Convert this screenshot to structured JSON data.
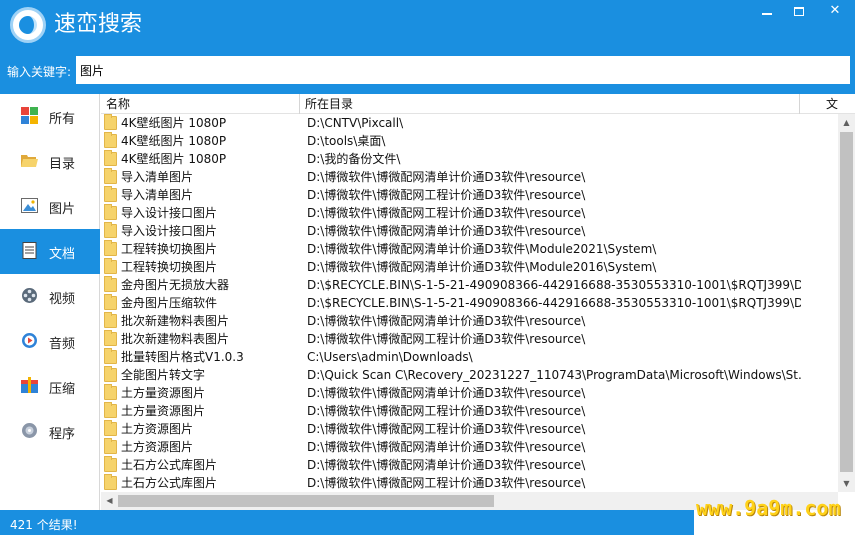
{
  "app": {
    "title": "速峦搜索"
  },
  "window_controls": {
    "minimize": "",
    "maximize": "",
    "close": "✕"
  },
  "search": {
    "label": "输入关键字:",
    "value": "图片"
  },
  "sidebar": {
    "items": [
      {
        "label": "所有",
        "icon": "grid-icon",
        "active": false
      },
      {
        "label": "目录",
        "icon": "folder-open-icon",
        "active": false
      },
      {
        "label": "图片",
        "icon": "picture-icon",
        "active": false
      },
      {
        "label": "文档",
        "icon": "document-icon",
        "active": true
      },
      {
        "label": "视频",
        "icon": "film-reel-icon",
        "active": false
      },
      {
        "label": "音频",
        "icon": "audio-play-icon",
        "active": false
      },
      {
        "label": "压缩",
        "icon": "archive-icon",
        "active": false
      },
      {
        "label": "程序",
        "icon": "program-disc-icon",
        "active": false
      }
    ]
  },
  "table": {
    "columns": [
      "名称",
      "所在目录",
      "文"
    ],
    "rows": [
      {
        "name": "4K壁纸图片 1080P",
        "path": "D:\\CNTV\\Pixcall\\"
      },
      {
        "name": "4K壁纸图片 1080P",
        "path": "D:\\tools\\桌面\\"
      },
      {
        "name": "4K壁纸图片 1080P",
        "path": "D:\\我的备份文件\\"
      },
      {
        "name": "导入清单图片",
        "path": "D:\\博微软件\\博微配网清单计价通D3软件\\resource\\"
      },
      {
        "name": "导入清单图片",
        "path": "D:\\博微软件\\博微配网工程计价通D3软件\\resource\\"
      },
      {
        "name": "导入设计接口图片",
        "path": "D:\\博微软件\\博微配网工程计价通D3软件\\resource\\"
      },
      {
        "name": "导入设计接口图片",
        "path": "D:\\博微软件\\博微配网清单计价通D3软件\\resource\\"
      },
      {
        "name": "工程转换切换图片",
        "path": "D:\\博微软件\\博微配网清单计价通D3软件\\Module2021\\System\\"
      },
      {
        "name": "工程转换切换图片",
        "path": "D:\\博微软件\\博微配网清单计价通D3软件\\Module2016\\System\\"
      },
      {
        "name": "金舟图片无损放大器",
        "path": "D:\\$RECYCLE.BIN\\S-1-5-21-490908366-442916688-3530553310-1001\\$RQTJ399\\D..."
      },
      {
        "name": "金舟图片压缩软件",
        "path": "D:\\$RECYCLE.BIN\\S-1-5-21-490908366-442916688-3530553310-1001\\$RQTJ399\\D..."
      },
      {
        "name": "批次新建物料表图片",
        "path": "D:\\博微软件\\博微配网清单计价通D3软件\\resource\\"
      },
      {
        "name": "批次新建物料表图片",
        "path": "D:\\博微软件\\博微配网工程计价通D3软件\\resource\\"
      },
      {
        "name": "批量转图片格式V1.0.3",
        "path": "C:\\Users\\admin\\Downloads\\"
      },
      {
        "name": "全能图片转文字",
        "path": "D:\\Quick Scan C\\Recovery_20231227_110743\\ProgramData\\Microsoft\\Windows\\St..."
      },
      {
        "name": "土方量资源图片",
        "path": "D:\\博微软件\\博微配网清单计价通D3软件\\resource\\"
      },
      {
        "name": "土方量资源图片",
        "path": "D:\\博微软件\\博微配网工程计价通D3软件\\resource\\"
      },
      {
        "name": "土方资源图片",
        "path": "D:\\博微软件\\博微配网工程计价通D3软件\\resource\\"
      },
      {
        "name": "土方资源图片",
        "path": "D:\\博微软件\\博微配网清单计价通D3软件\\resource\\"
      },
      {
        "name": "土石方公式库图片",
        "path": "D:\\博微软件\\博微配网清单计价通D3软件\\resource\\"
      },
      {
        "name": "土石方公式库图片",
        "path": "D:\\博微软件\\博微配网工程计价通D3软件\\resource\\"
      }
    ]
  },
  "status": {
    "text": "421 个结果!"
  },
  "watermark": {
    "text": "www.9a9m.com"
  },
  "colors": {
    "accent": "#1a8fe0",
    "folder": "#f6d36b",
    "watermark": "#ffd21a"
  }
}
